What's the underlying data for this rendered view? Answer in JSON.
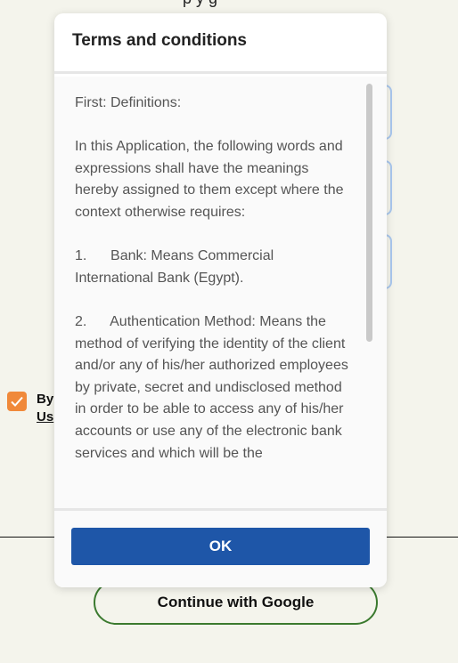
{
  "background": {
    "top_fragment": "p y g",
    "consent_line_1": "By",
    "consent_line_2": "Us",
    "google_button_label": "Continue with Google",
    "checkbox_checked": true,
    "accent_color": "#f0893a"
  },
  "dialog": {
    "title": "Terms and conditions",
    "paragraphs": [
      "First: Definitions:",
      "In this Application, the following words and expressions shall have the meanings hereby assigned to them except where the context otherwise requires:",
      "1.      Bank: Means Commercial International Bank (Egypt).",
      "2.      Authentication Method: Means the method of verifying the identity of the client and/or any of his/her authorized employees by private, secret and undisclosed method in order to be able to access any of his/her accounts or use any of the electronic bank services and which will be the"
    ],
    "ok_label": "OK",
    "primary_color": "#1e56a8"
  }
}
